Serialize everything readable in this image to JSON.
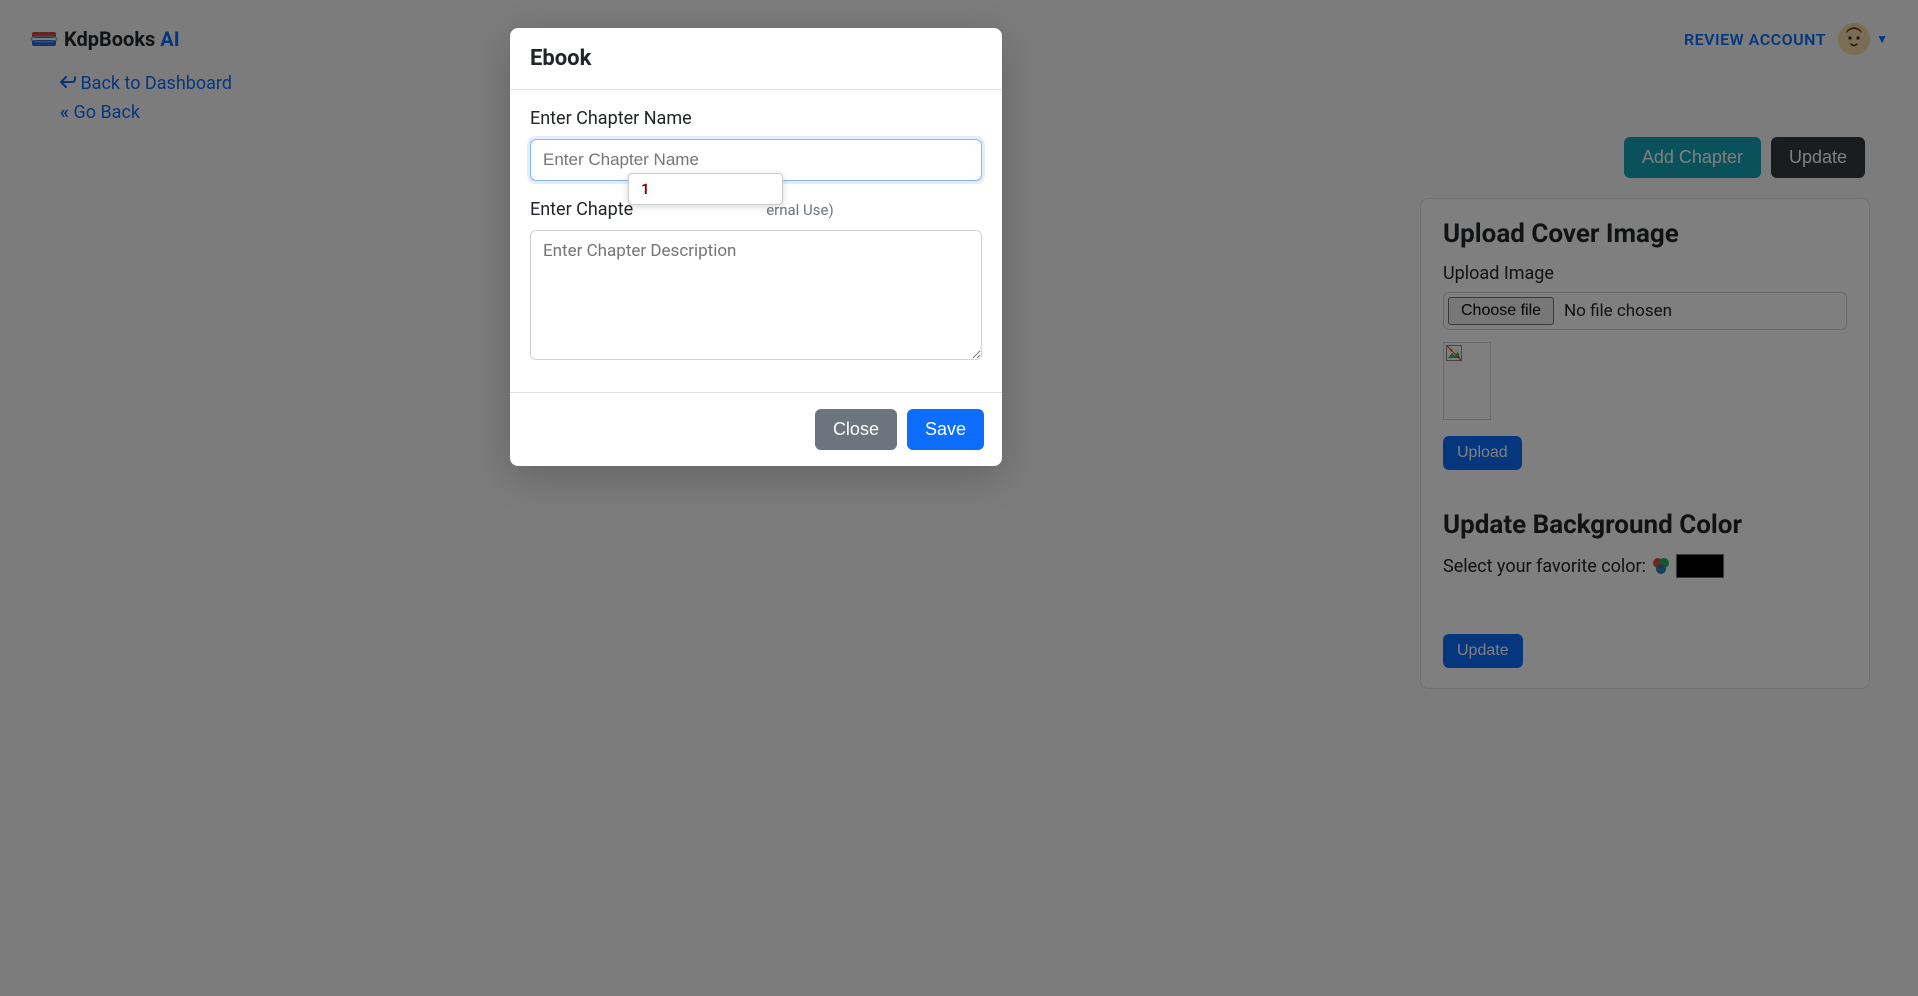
{
  "header": {
    "brand_text": "KdpBooks ",
    "brand_ai": "AI",
    "review_account": "REVIEW ACCOUNT"
  },
  "nav": {
    "back_dashboard": "Back to Dashboard",
    "go_back": "Go Back"
  },
  "actions": {
    "add_chapter": "Add Chapter",
    "update": "Update"
  },
  "cover_card": {
    "title": "Upload Cover Image",
    "upload_image_label": "Upload Image",
    "choose_file": "Choose file",
    "no_file": "No file chosen",
    "upload_button": "Upload"
  },
  "bg_card": {
    "title": "Update Background Color",
    "select_label": "Select your favorite color:",
    "update_button": "Update",
    "color_value": "#000000"
  },
  "modal": {
    "title": "Ebook",
    "chapter_name_label": "Enter Chapter Name",
    "chapter_name_placeholder": "Enter Chapter Name",
    "chapter_desc_label_pre": "Enter Chapte",
    "chapter_desc_label_post": "ernal Use)",
    "chapter_desc_placeholder": "Enter Chapter Description",
    "close": "Close",
    "save": "Save",
    "autofill_item": "1"
  }
}
